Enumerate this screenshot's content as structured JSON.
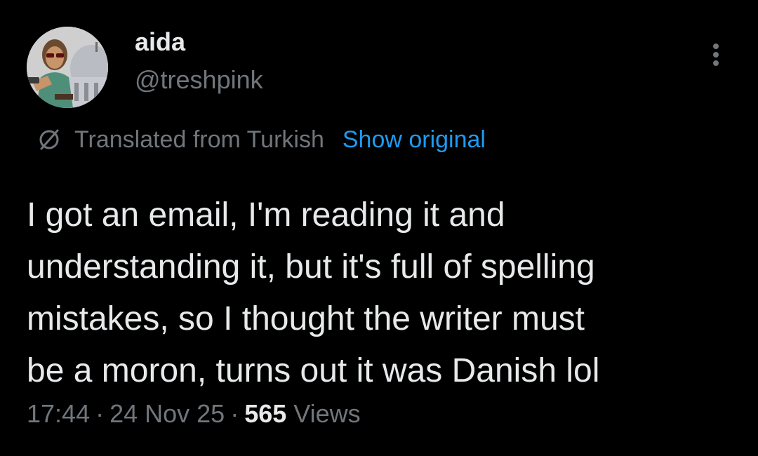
{
  "author": {
    "display_name": "aida",
    "handle": "@treshpink",
    "avatar_icon": "profile-avatar"
  },
  "more_icon": "more-vertical-icon",
  "translation": {
    "icon": "translate-icon",
    "label": "Translated from Turkish",
    "show_original": "Show original"
  },
  "tweet": {
    "lines": [
      "I got an email, I'm reading it and",
      "understanding it, but it's full of spelling",
      "mistakes, so I thought the writer must",
      "be a moron, turns out it was Danish lol"
    ]
  },
  "meta": {
    "time": "17:44",
    "separator": "·",
    "date": "24 Nov 25",
    "views_count": "565",
    "views_label": "Views"
  },
  "colors": {
    "background": "#000000",
    "text_primary": "#e7e9ea",
    "text_secondary": "#71767b",
    "link": "#1d9bf0"
  }
}
